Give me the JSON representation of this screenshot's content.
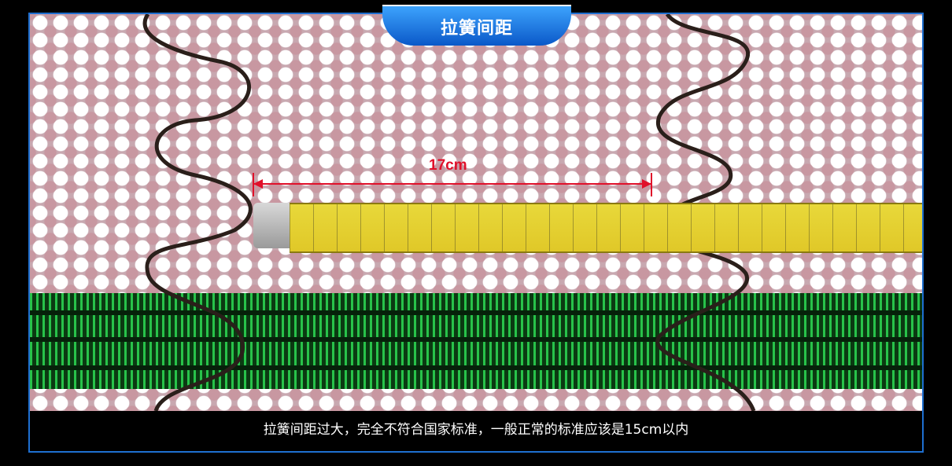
{
  "title": "拉簧间距",
  "measurement": "17cm",
  "caption": "拉簧间距过大，完全不符合国家标准，一般正常的标准应该是15cm以内",
  "colors": {
    "frame_blue": "#1e6fd0",
    "measurement_red": "#e0102a",
    "webbing_green": "#28c24a",
    "tape_yellow": "#e8d83a"
  }
}
